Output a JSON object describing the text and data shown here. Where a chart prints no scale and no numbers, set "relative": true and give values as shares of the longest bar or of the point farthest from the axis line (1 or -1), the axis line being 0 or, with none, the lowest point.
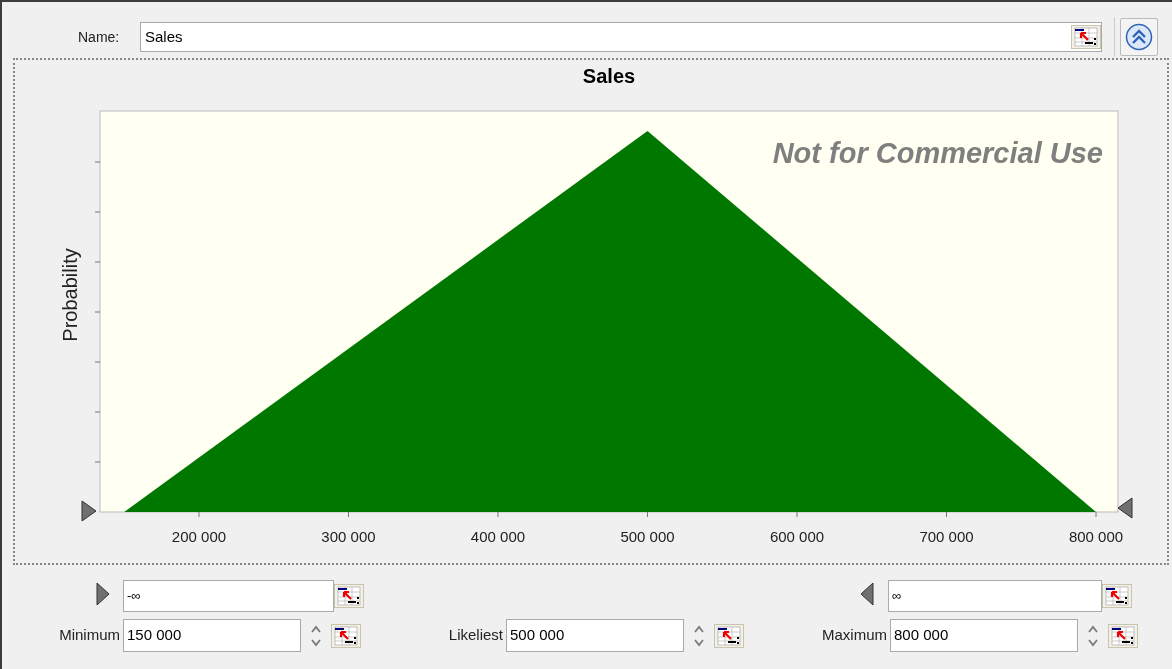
{
  "name_field": {
    "label": "Name:",
    "value": "Sales"
  },
  "chart": {
    "watermark": "Not for Commercial Use",
    "chart_data": {
      "type": "area",
      "title": "Sales",
      "ylabel": "Probability",
      "x": [
        150000,
        500000,
        800000
      ],
      "relative": true,
      "series": [
        {
          "color": "#007800",
          "values": [
            0,
            1,
            0
          ]
        }
      ],
      "xlim": [
        133800,
        814700
      ],
      "xticks": [
        {
          "value": 200000,
          "label": "200 000"
        },
        {
          "value": 300000,
          "label": "300 000"
        },
        {
          "value": 400000,
          "label": "400 000"
        },
        {
          "value": 500000,
          "label": "500 000"
        },
        {
          "value": 600000,
          "label": "600 000"
        },
        {
          "value": 700000,
          "label": "700 000"
        },
        {
          "value": 800000,
          "label": "800 000"
        }
      ]
    }
  },
  "range": {
    "lower": "-∞",
    "upper": "∞"
  },
  "parameters": [
    {
      "label": "Minimum",
      "value": "150 000"
    },
    {
      "label": "Likeliest",
      "value": "500 000"
    },
    {
      "label": "Maximum",
      "value": "800 000"
    }
  ]
}
